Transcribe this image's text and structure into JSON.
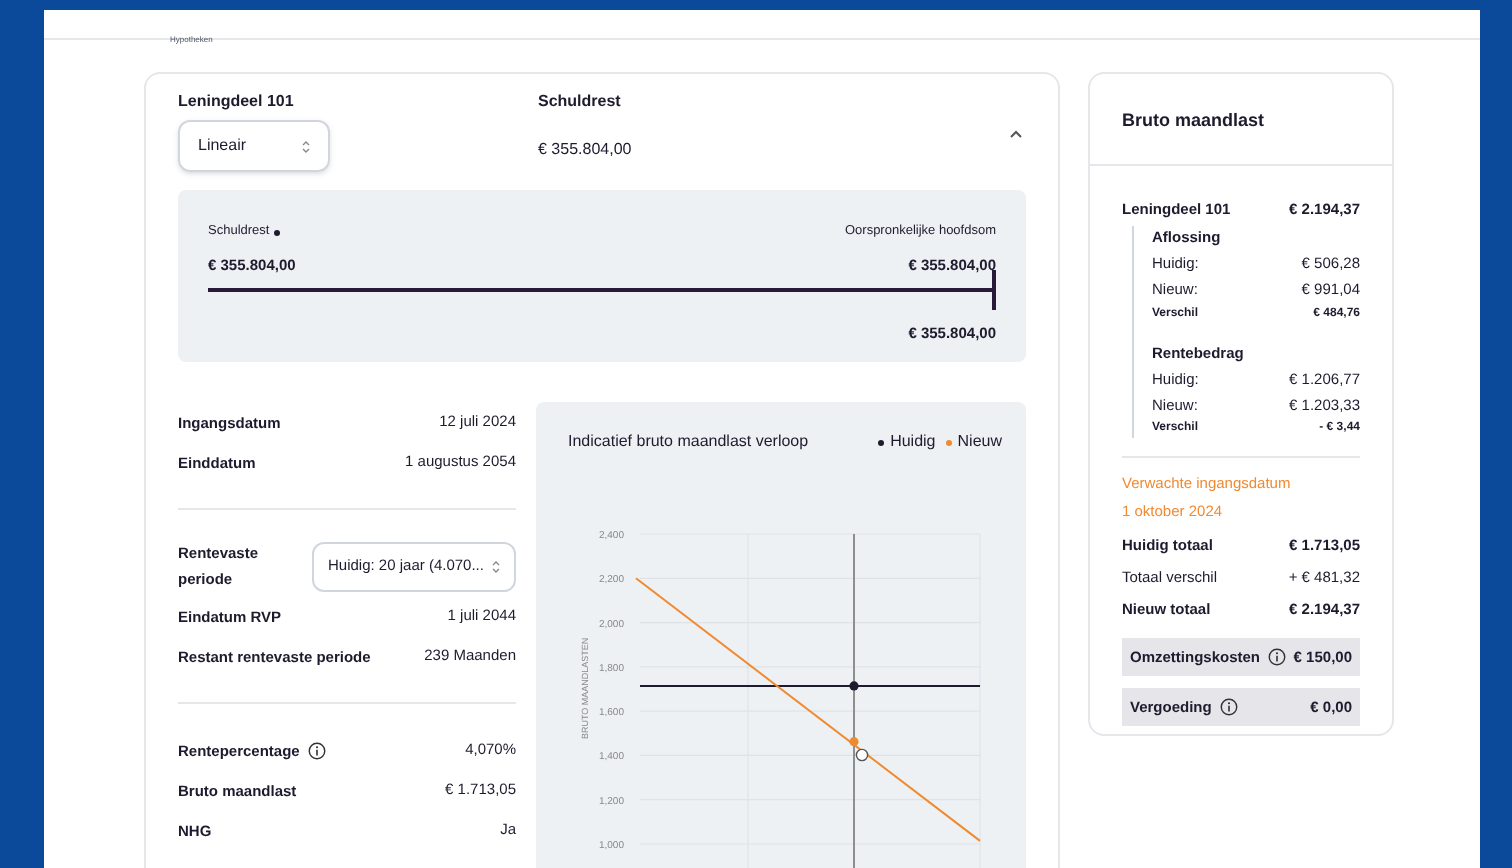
{
  "header": {
    "logo_caption": "Hypotheken"
  },
  "loan_part": {
    "title": "Leningdeel 101",
    "type_select": {
      "value": "Lineair"
    },
    "debt_label": "Schuldrest",
    "debt_value": "€ 355.804,00",
    "expanded": true
  },
  "debt_bar": {
    "left_label": "Schuldrest",
    "left_value": "€ 355.804,00",
    "right_label": "Oorspronkelijke hoofdsom",
    "right_value": "€ 355.804,00",
    "level": 1,
    "bottom_value": "€ 355.804,00"
  },
  "details": [
    {
      "kind": "row",
      "label": "Ingangsdatum",
      "value": "12 juli 2024"
    },
    {
      "kind": "row",
      "label": "Einddatum",
      "value": "1 augustus 2054"
    },
    {
      "kind": "divider"
    },
    {
      "kind": "select",
      "label": "Rentevaste periode",
      "value": "Huidig: 20 jaar (4.070..."
    },
    {
      "kind": "row",
      "label": "Eindatum RVP",
      "value": "1 juli 2044"
    },
    {
      "kind": "row",
      "label": "Restant rentevaste periode",
      "value": "239 Maanden"
    },
    {
      "kind": "divider"
    },
    {
      "kind": "info",
      "label": "Rentepercentage",
      "value": "4,070%"
    },
    {
      "kind": "row",
      "label": "Bruto maandlast",
      "value": "€ 1.713,05"
    },
    {
      "kind": "row",
      "label": "NHG",
      "value": "Ja"
    }
  ],
  "chart": {
    "title": "Indicatief bruto maandlast verloop",
    "y_axis_title": "BRUTO MAANDLASTEN",
    "y_tick_labels": [
      "2,400",
      "2,200",
      "2,000",
      "1,800",
      "1,600",
      "1,400",
      "1,200",
      "1,000"
    ],
    "legend": [
      {
        "name": "Huidig",
        "color": "#1e1b2e"
      },
      {
        "name": "Nieuw",
        "color": "#f08a30"
      }
    ]
  },
  "summary": {
    "title": "Bruto maandlast",
    "loan_label": "Leningdeel 101",
    "loan_value": "€ 2.194,37",
    "groups": [
      {
        "title": "Aflossing",
        "rows": [
          {
            "kind": "normal",
            "label": "Huidig:",
            "value": "€ 506,28"
          },
          {
            "kind": "normal",
            "label": "Nieuw:",
            "value": "€ 991,04"
          },
          {
            "kind": "small-bold",
            "label": "Verschil",
            "value": "€ 484,76"
          }
        ]
      },
      {
        "title": "Rentebedrag",
        "rows": [
          {
            "kind": "normal",
            "label": "Huidig:",
            "value": "€ 1.206,77"
          },
          {
            "kind": "normal",
            "label": "Nieuw:",
            "value": "€ 1.203,33"
          },
          {
            "kind": "small-bold",
            "label": "Verschil",
            "value": "- € 3,44"
          }
        ]
      }
    ],
    "expected_label": "Verwachte ingangsdatum",
    "expected_date": "1 oktober 2024",
    "totals": [
      {
        "kind": "bold",
        "label": "Huidig totaal",
        "value": "€ 1.713,05"
      },
      {
        "kind": "normal",
        "label": "Totaal verschil",
        "value": "+ € 481,32"
      },
      {
        "kind": "bold",
        "label": "Nieuw totaal",
        "value": "€ 2.194,37"
      },
      {
        "kind": "shaded-info",
        "label": "Omzettingskosten",
        "value": "€ 150,00"
      },
      {
        "kind": "shaded-info",
        "label": "Vergoeding",
        "value": "€ 0,00"
      }
    ]
  }
}
